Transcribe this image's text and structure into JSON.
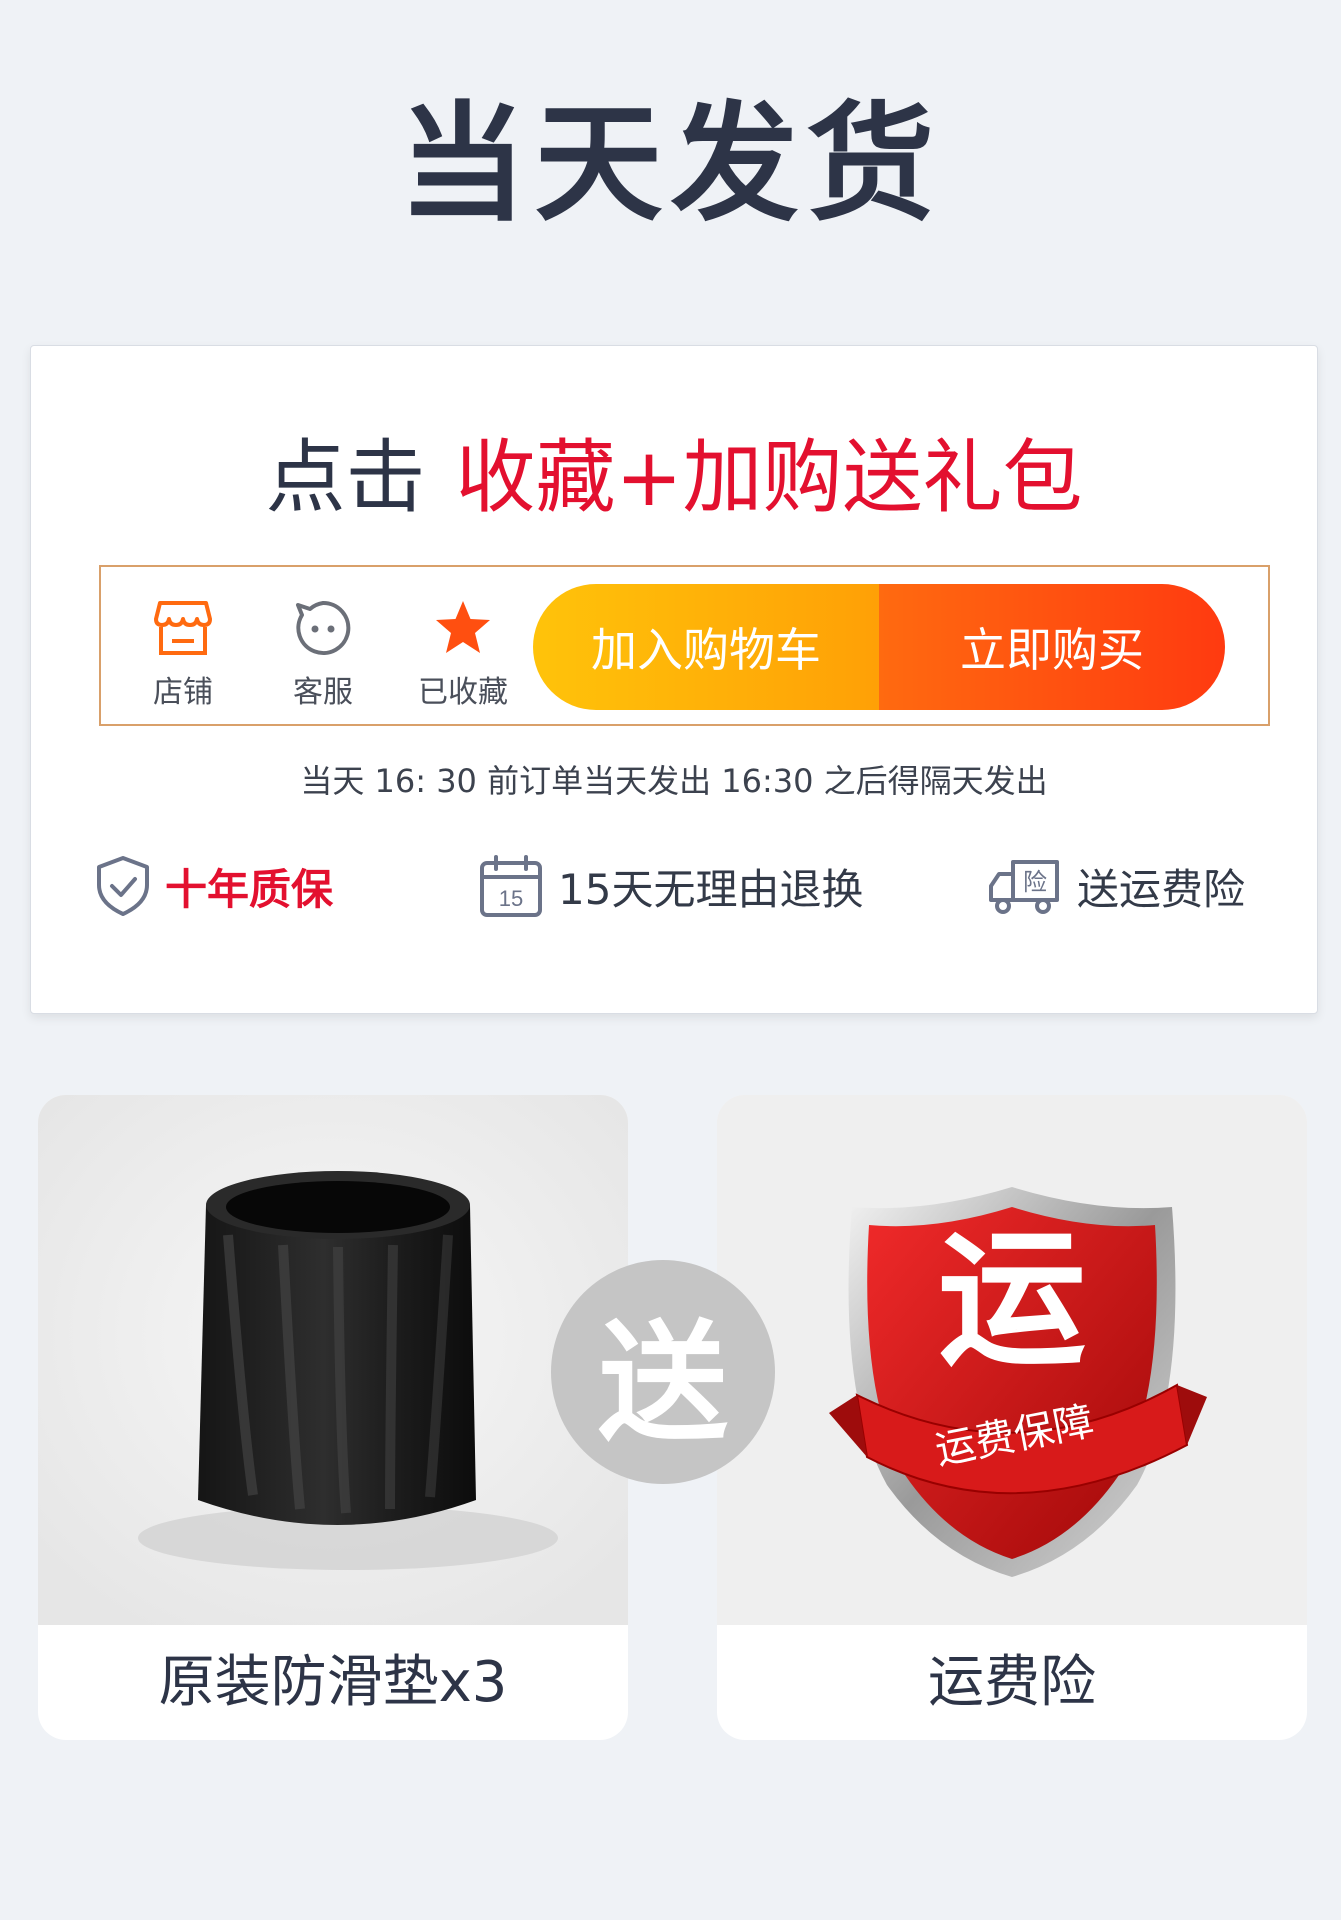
{
  "header": {
    "title": "当天发货"
  },
  "promo": {
    "prefix": "点击",
    "highlight": "收藏+加购送礼包"
  },
  "actionbar": {
    "store_label": "店铺",
    "service_label": "客服",
    "favorite_label": "已收藏",
    "add_to_cart": "加入购物车",
    "buy_now": "立即购买"
  },
  "shipping_note": "当天 16: 30 前订单当天发出 16:30 之后得隔天发出",
  "guarantees": {
    "warranty": "十年质保",
    "return_calendar_day": "15",
    "returns": "15天无理由退换",
    "insurance_badge": "险",
    "insurance": "送运费险"
  },
  "gifts": {
    "plus": "送",
    "item1": "原装防滑垫x3",
    "shield_char": "运",
    "shield_ribbon": "运费保障",
    "item2": "运费险"
  },
  "colors": {
    "accent_red": "#e3102f",
    "cart_yellow": "#ffb20a",
    "buy_orange": "#ff5510",
    "title_navy": "#2d3447"
  }
}
